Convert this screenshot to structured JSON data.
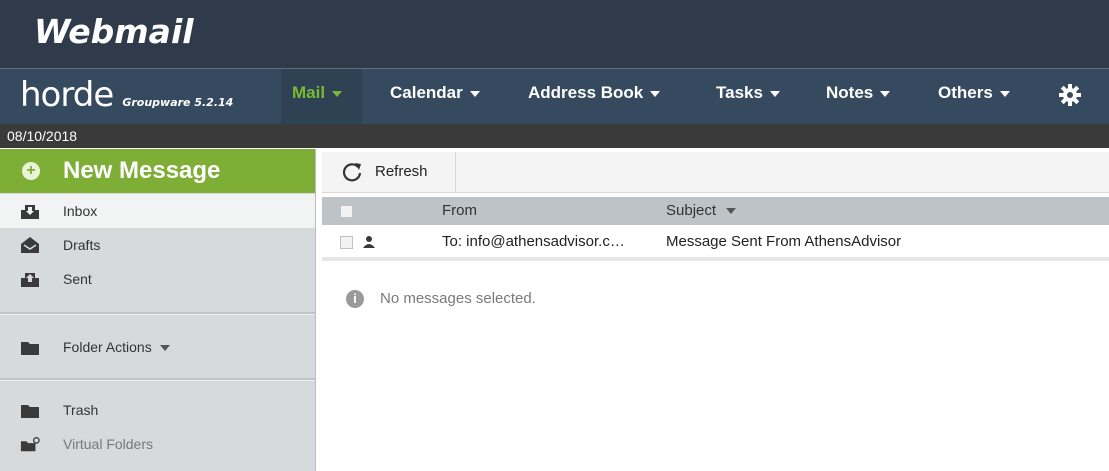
{
  "banner": {
    "brand": "Webmail"
  },
  "menubar": {
    "logo_main": "horde",
    "logo_sub": "Groupware 5.2.14",
    "items": [
      {
        "label": "Mail"
      },
      {
        "label": "Calendar"
      },
      {
        "label": "Address Book"
      },
      {
        "label": "Tasks"
      },
      {
        "label": "Notes"
      },
      {
        "label": "Others"
      }
    ],
    "active_color": "#79b934"
  },
  "datebar": {
    "date": "08/10/2018"
  },
  "sidebar": {
    "new_message": "New Message",
    "folders": [
      {
        "label": "Inbox",
        "icon": "inbox-icon"
      },
      {
        "label": "Drafts",
        "icon": "drafts-icon"
      },
      {
        "label": "Sent",
        "icon": "sent-icon"
      }
    ],
    "folder_actions": "Folder Actions",
    "bottom_folders": [
      {
        "label": "Trash",
        "icon": "folder-icon"
      },
      {
        "label": "Virtual Folders",
        "icon": "virtual-folder-icon"
      }
    ]
  },
  "toolbar": {
    "refresh": "Refresh"
  },
  "list": {
    "headers": {
      "from": "From",
      "subject": "Subject"
    },
    "rows": [
      {
        "from": "To: info@athensadvisor.c…",
        "subject": "Message Sent From AthensAdvisor"
      }
    ]
  },
  "preview": {
    "empty": "No messages selected."
  }
}
